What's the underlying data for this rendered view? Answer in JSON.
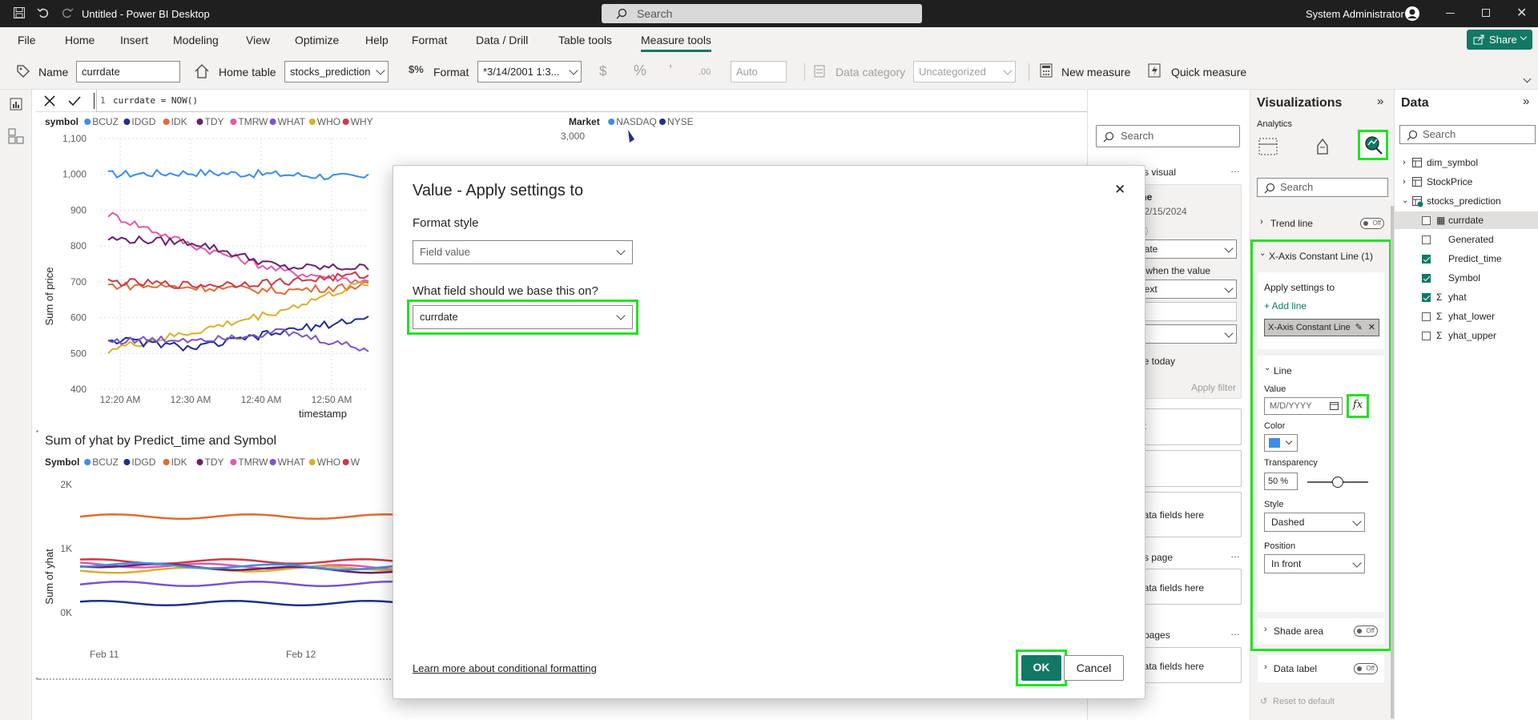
{
  "titlebar": {
    "title": "Untitled - Power BI Desktop",
    "search_placeholder": "Search",
    "user": "System Administrator"
  },
  "menu": {
    "items": [
      "File",
      "Home",
      "Insert",
      "Modeling",
      "View",
      "Optimize",
      "Help",
      "Format",
      "Data / Drill",
      "Table tools",
      "Measure tools"
    ],
    "active": "Measure tools",
    "share": "Share"
  },
  "ribbon": {
    "name_label": "Name",
    "name_value": "currdate",
    "home_table_label": "Home table",
    "home_table_value": "stocks_prediction",
    "format_label": "Format",
    "format_value": "*3/14/2001 1:3...",
    "currency": "$",
    "percent": "%",
    "comma": "’",
    "decimal": ".00",
    "auto": "Auto",
    "data_category_label": "Data category",
    "data_category_value": "Uncategorized",
    "new_measure": "New measure",
    "quick_measure": "Quick measure"
  },
  "formula": {
    "line": "1",
    "text": "currdate = NOW()"
  },
  "chart_top": {
    "type": "line",
    "legend_title": "symbol",
    "legend": [
      {
        "name": "BCUZ",
        "color": "#3b8ee8"
      },
      {
        "name": "IDGD",
        "color": "#1f2f8c"
      },
      {
        "name": "IDK",
        "color": "#e06b33"
      },
      {
        "name": "TDY",
        "color": "#6b1f6b"
      },
      {
        "name": "TMRW",
        "color": "#e05aa8"
      },
      {
        "name": "WHAT",
        "color": "#7a55c8"
      },
      {
        "name": "WHO",
        "color": "#d6b02e"
      },
      {
        "name": "WHY",
        "color": "#c83c48"
      }
    ],
    "ylabel": "Sum of price",
    "xlabel": "timestamp",
    "yticks": [
      "1,100",
      "1,000",
      "900",
      "800",
      "700",
      "600",
      "500",
      "400"
    ],
    "xticks": [
      "12:20 AM",
      "12:30 AM",
      "12:40 AM",
      "12:50 AM"
    ],
    "ylim": [
      400,
      1100
    ]
  },
  "chart_market": {
    "legend_title": "Market",
    "legend": [
      {
        "name": "NASDAQ",
        "color": "#3b8ee8"
      },
      {
        "name": "NYSE",
        "color": "#1f2f8c"
      }
    ],
    "ytick": "3,000"
  },
  "chart_bottom": {
    "type": "line",
    "title": "Sum of yhat by Predict_time and Symbol",
    "legend_title": "Symbol",
    "legend": [
      {
        "name": "BCUZ",
        "color": "#3b8ee8"
      },
      {
        "name": "IDGD",
        "color": "#1f2f8c"
      },
      {
        "name": "IDK",
        "color": "#e06b33"
      },
      {
        "name": "TDY",
        "color": "#6b1f6b"
      },
      {
        "name": "TMRW",
        "color": "#e05aa8"
      },
      {
        "name": "WHAT",
        "color": "#7a55c8"
      },
      {
        "name": "WHO",
        "color": "#d6b02e"
      },
      {
        "name": "W",
        "color": "#c83c48"
      }
    ],
    "ylabel": "Sum of yhat",
    "yticks": [
      "2K",
      "1K",
      "0K"
    ],
    "xticks": [
      "Feb 11",
      "Feb 12"
    ]
  },
  "chart_data": [
    {
      "type": "line",
      "title": "",
      "xlabel": "timestamp",
      "ylabel": "Sum of price",
      "ylim": [
        400,
        1100
      ],
      "x": [
        "12:20 AM",
        "12:30 AM",
        "12:40 AM",
        "12:50 AM"
      ],
      "series": [
        {
          "name": "BCUZ",
          "values": [
            1000,
            1005,
            1000,
            990
          ]
        },
        {
          "name": "TMRW",
          "values": [
            890,
            800,
            730,
            700
          ]
        },
        {
          "name": "TDY",
          "values": [
            820,
            810,
            740,
            740
          ]
        },
        {
          "name": "IDK",
          "values": [
            690,
            685,
            675,
            690
          ]
        },
        {
          "name": "WHY",
          "values": [
            700,
            690,
            700,
            720
          ]
        },
        {
          "name": "WHO",
          "values": [
            510,
            560,
            620,
            700
          ]
        },
        {
          "name": "IDGD",
          "values": [
            540,
            515,
            560,
            600
          ]
        },
        {
          "name": "WHAT",
          "values": [
            535,
            540,
            560,
            510
          ]
        }
      ]
    },
    {
      "type": "line",
      "title": "Sum of yhat by Predict_time and Symbol",
      "ylabel": "Sum of yhat",
      "x": [
        "Feb 11",
        "Feb 12"
      ],
      "series": [
        {
          "name": "IDK",
          "values": [
            1500,
            1500
          ]
        },
        {
          "name": "WHY",
          "values": [
            800,
            800
          ]
        },
        {
          "name": "TMRW",
          "values": [
            750,
            700
          ]
        },
        {
          "name": "WHO",
          "values": [
            650,
            700
          ]
        },
        {
          "name": "TDY",
          "values": [
            750,
            650
          ]
        },
        {
          "name": "BCUZ",
          "values": [
            750,
            700
          ]
        },
        {
          "name": "WHAT",
          "values": [
            450,
            450
          ]
        },
        {
          "name": "IDGD",
          "values": [
            150,
            150
          ]
        }
      ]
    }
  ],
  "filters": {
    "search_placeholder": "Search",
    "on_visual": "s visual",
    "card1_title": "me",
    "card1_range": "- 2/15/2024",
    "card1_dd1": "date",
    "card1_when": "s when the value",
    "card1_dd2": "next",
    "card1_include": "de today",
    "card1_apply": "Apply filter",
    "card2": "at",
    "drop1": "data fields here",
    "on_page": "s page",
    "drop2": "data fields here",
    "all_pages": "pages",
    "drop3": "data fields here"
  },
  "viz": {
    "title": "Visualizations",
    "analytics": "Analytics",
    "search_placeholder": "Search",
    "trend_line": "Trend line",
    "toggle_off": "Off",
    "xaxis_line": "X-Axis Constant Line (1)",
    "apply_settings": "Apply settings to",
    "add_line": "+ Add line",
    "line_chip": "X-Axis Constant Line",
    "line_section": "Line",
    "value_label": "Value",
    "value_placeholder": "M/D/YYYY",
    "color_label": "Color",
    "color_value": "#3b8ee8",
    "transparency_label": "Transparency",
    "transparency_value": "50 %",
    "transparency_level": 0.5,
    "style_label": "Style",
    "style_value": "Dashed",
    "position_label": "Position",
    "position_value": "In front",
    "shade_area": "Shade area",
    "data_label": "Data label",
    "reset": "Reset to default"
  },
  "data": {
    "title": "Data",
    "search_placeholder": "Search",
    "tables": [
      "dim_symbol",
      "StockPrice",
      "stocks_prediction"
    ],
    "fields": [
      {
        "name": "currdate",
        "checked": false,
        "kind": "calc"
      },
      {
        "name": "Generated",
        "checked": false,
        "kind": ""
      },
      {
        "name": "Predict_time",
        "checked": true,
        "kind": ""
      },
      {
        "name": "Symbol",
        "checked": true,
        "kind": ""
      },
      {
        "name": "yhat",
        "checked": true,
        "kind": "sum"
      },
      {
        "name": "yhat_lower",
        "checked": false,
        "kind": "sum"
      },
      {
        "name": "yhat_upper",
        "checked": false,
        "kind": "sum"
      }
    ]
  },
  "modal": {
    "title": "Value - Apply settings to",
    "format_style_label": "Format style",
    "format_style_value": "Field value",
    "field_question": "What field should we base this on?",
    "field_value": "currdate",
    "learn_more": "Learn more about conditional formatting",
    "ok": "OK",
    "cancel": "Cancel"
  }
}
